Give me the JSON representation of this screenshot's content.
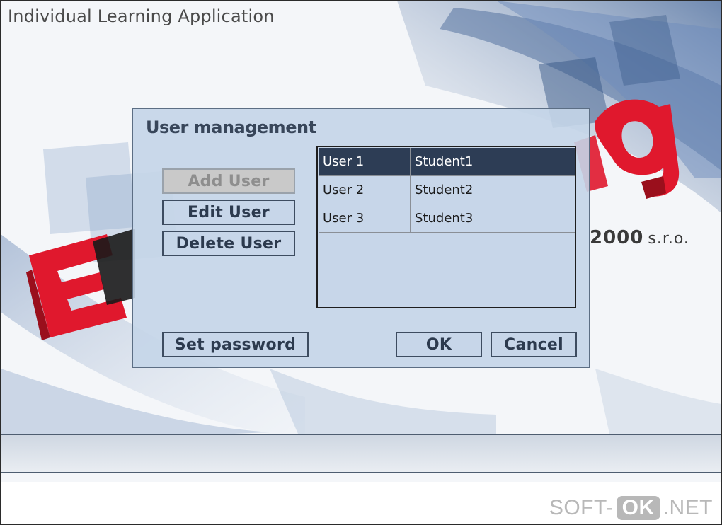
{
  "window": {
    "app_title": "Individual Learning Application",
    "company_name": "2000",
    "company_suffix": "s.r.o.",
    "accent_color": "#e0182d",
    "dialog_color": "#c4d5e8"
  },
  "dialog": {
    "title": "User management",
    "buttons": {
      "add_user": "Add User",
      "edit_user": "Edit User",
      "delete_user": "Delete User",
      "set_password": "Set password",
      "ok": "OK",
      "cancel": "Cancel"
    },
    "add_user_enabled": false,
    "users": [
      {
        "id": "User 1",
        "name": "Student1",
        "selected": true
      },
      {
        "id": "User 2",
        "name": "Student2",
        "selected": false
      },
      {
        "id": "User 3",
        "name": "Student3",
        "selected": false
      }
    ]
  },
  "watermark": {
    "prefix": "SOFT-",
    "highlight": "OK",
    "suffix": ".NET"
  }
}
